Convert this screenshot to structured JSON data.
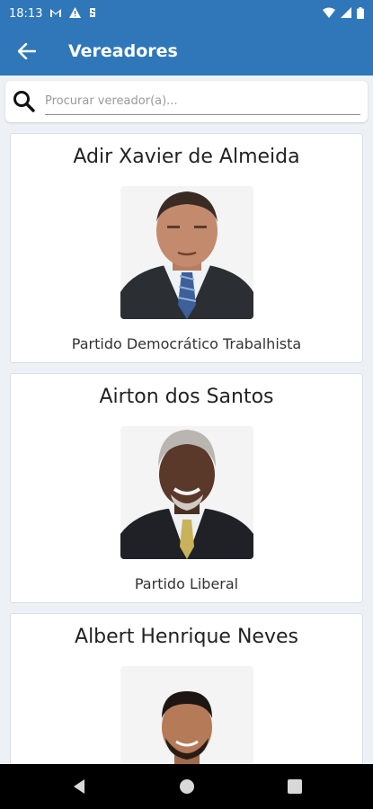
{
  "status_bar": {
    "time": "18:13",
    "icons": [
      "gmail-icon",
      "alert-icon",
      "sync-icon",
      "wifi-icon",
      "signal-icon",
      "battery-icon"
    ]
  },
  "app_bar": {
    "title": "Vereadores",
    "back_icon": "arrow-back-icon"
  },
  "search": {
    "placeholder": "Procurar vereador(a)...",
    "value": ""
  },
  "vereadores": [
    {
      "name": "Adir Xavier de Almeida",
      "party": "Partido Democrático Trabalhista"
    },
    {
      "name": "Airton dos Santos",
      "party": "Partido Liberal"
    },
    {
      "name": "Albert Henrique Neves",
      "party": ""
    }
  ],
  "nav": {
    "back": "nav-back-icon",
    "home": "nav-home-icon",
    "recents": "nav-recents-icon"
  },
  "colors": {
    "primary": "#2f77b8",
    "background": "#edf1f5",
    "card": "#ffffff"
  }
}
